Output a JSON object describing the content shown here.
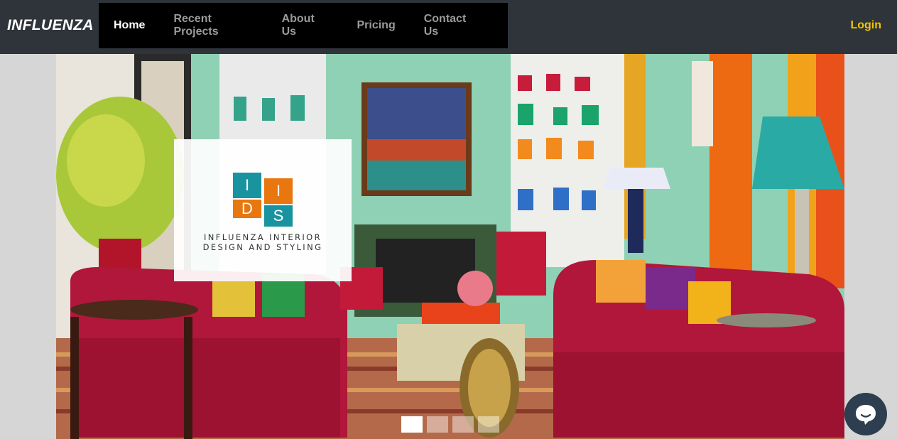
{
  "brand": "INFLUENZA",
  "nav": {
    "items": [
      {
        "label": "Home",
        "active": true
      },
      {
        "label": "Recent Projects",
        "active": false
      },
      {
        "label": "About Us",
        "active": false
      },
      {
        "label": "Pricing",
        "active": false
      },
      {
        "label": "Contact Us",
        "active": false
      }
    ],
    "login": "Login"
  },
  "hero": {
    "logo": {
      "letters": [
        "I",
        "I",
        "D",
        "S"
      ],
      "line1": "INFLUENZA INTERIOR",
      "line2": "DESIGN AND STYLING",
      "colors": {
        "teal": "#1a93a0",
        "orange": "#e8770f"
      }
    },
    "slide_count": 4,
    "active_slide": 1
  },
  "chat": {
    "icon": "chat-bubble-icon"
  },
  "colors": {
    "navbar": "#2f343b",
    "menu": "#000000",
    "accent": "#f2c400"
  }
}
